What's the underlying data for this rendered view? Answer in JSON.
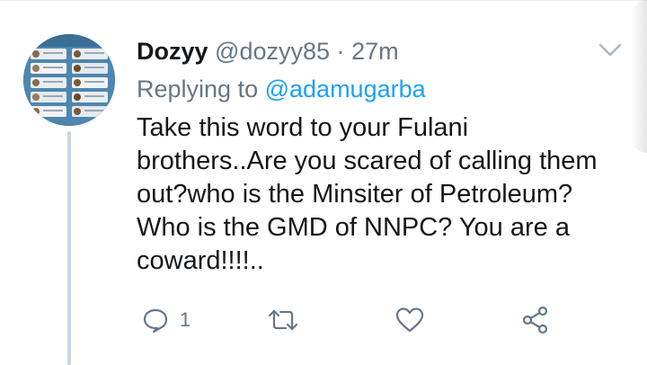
{
  "tweet": {
    "display_name": "Dozyy",
    "handle": "@dozyy85",
    "separator": "·",
    "timestamp": "27m",
    "replying_prefix": "Replying to",
    "replying_to": "@adamugarba",
    "text_lines": [
      "Take this word to your Fulani",
      "brothers..Are you scared of calling them",
      "out?who is the Minsiter of Petroleum?",
      "Who is the GMD of NNPC? You are a",
      "coward!!!!.."
    ]
  },
  "actions": {
    "reply_count": "1"
  },
  "colors": {
    "text_primary": "#14171a",
    "text_secondary": "#657786",
    "link_blue": "#1da1f2",
    "thread_line": "#ccd6dd"
  },
  "icons": [
    "chevron-down-icon",
    "reply-icon",
    "retweet-icon",
    "like-icon",
    "share-icon"
  ]
}
